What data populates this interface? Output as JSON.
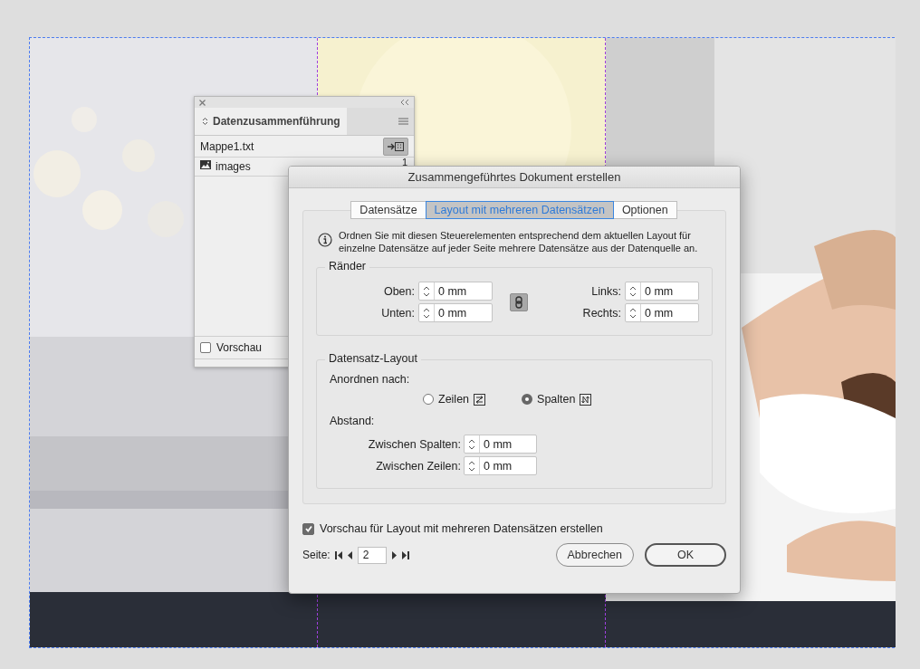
{
  "panel": {
    "title": "Datenzusammenführung",
    "source": "Mappe1.txt",
    "fields": [
      {
        "name": "images",
        "count": "1"
      }
    ],
    "preview": {
      "label": "Vorschau",
      "checked": false
    }
  },
  "dialog": {
    "title": "Zusammengeführtes Dokument erstellen",
    "tabs": [
      {
        "label": "Datensätze",
        "selected": false
      },
      {
        "label": "Layout mit mehreren Datensätzen",
        "selected": true
      },
      {
        "label": "Optionen",
        "selected": false
      }
    ],
    "info": "Ordnen Sie mit diesen Steuerelementen entsprechend dem aktuellen Layout für einzelne Datensätze auf jeder Seite mehrere Datensätze aus der Datenquelle an.",
    "margins": {
      "legend": "Ränder",
      "left_fields": [
        {
          "label": "Oben:",
          "value": "0 mm"
        },
        {
          "label": "Unten:",
          "value": "0 mm"
        }
      ],
      "right_fields": [
        {
          "label": "Links:",
          "value": "0 mm"
        },
        {
          "label": "Rechts:",
          "value": "0 mm"
        }
      ]
    },
    "record_layout": {
      "legend": "Datensatz-Layout",
      "arrange_label": "Anordnen nach:",
      "arrange_options": [
        {
          "label": "Zeilen",
          "kind": "rows",
          "selected": false
        },
        {
          "label": "Spalten",
          "kind": "columns",
          "selected": true
        }
      ],
      "spacing_label": "Abstand:",
      "spacing_fields": [
        {
          "label": "Zwischen Spalten:",
          "value": "0 mm"
        },
        {
          "label": "Zwischen Zeilen:",
          "value": "0 mm"
        }
      ]
    },
    "preview": {
      "label": "Vorschau für Layout mit mehreren Datensätzen erstellen",
      "checked": true
    },
    "page": {
      "label": "Seite:",
      "value": "2"
    },
    "buttons": [
      {
        "label": "Abbrechen",
        "kind": "cancel"
      },
      {
        "label": "OK",
        "kind": "default"
      }
    ]
  }
}
